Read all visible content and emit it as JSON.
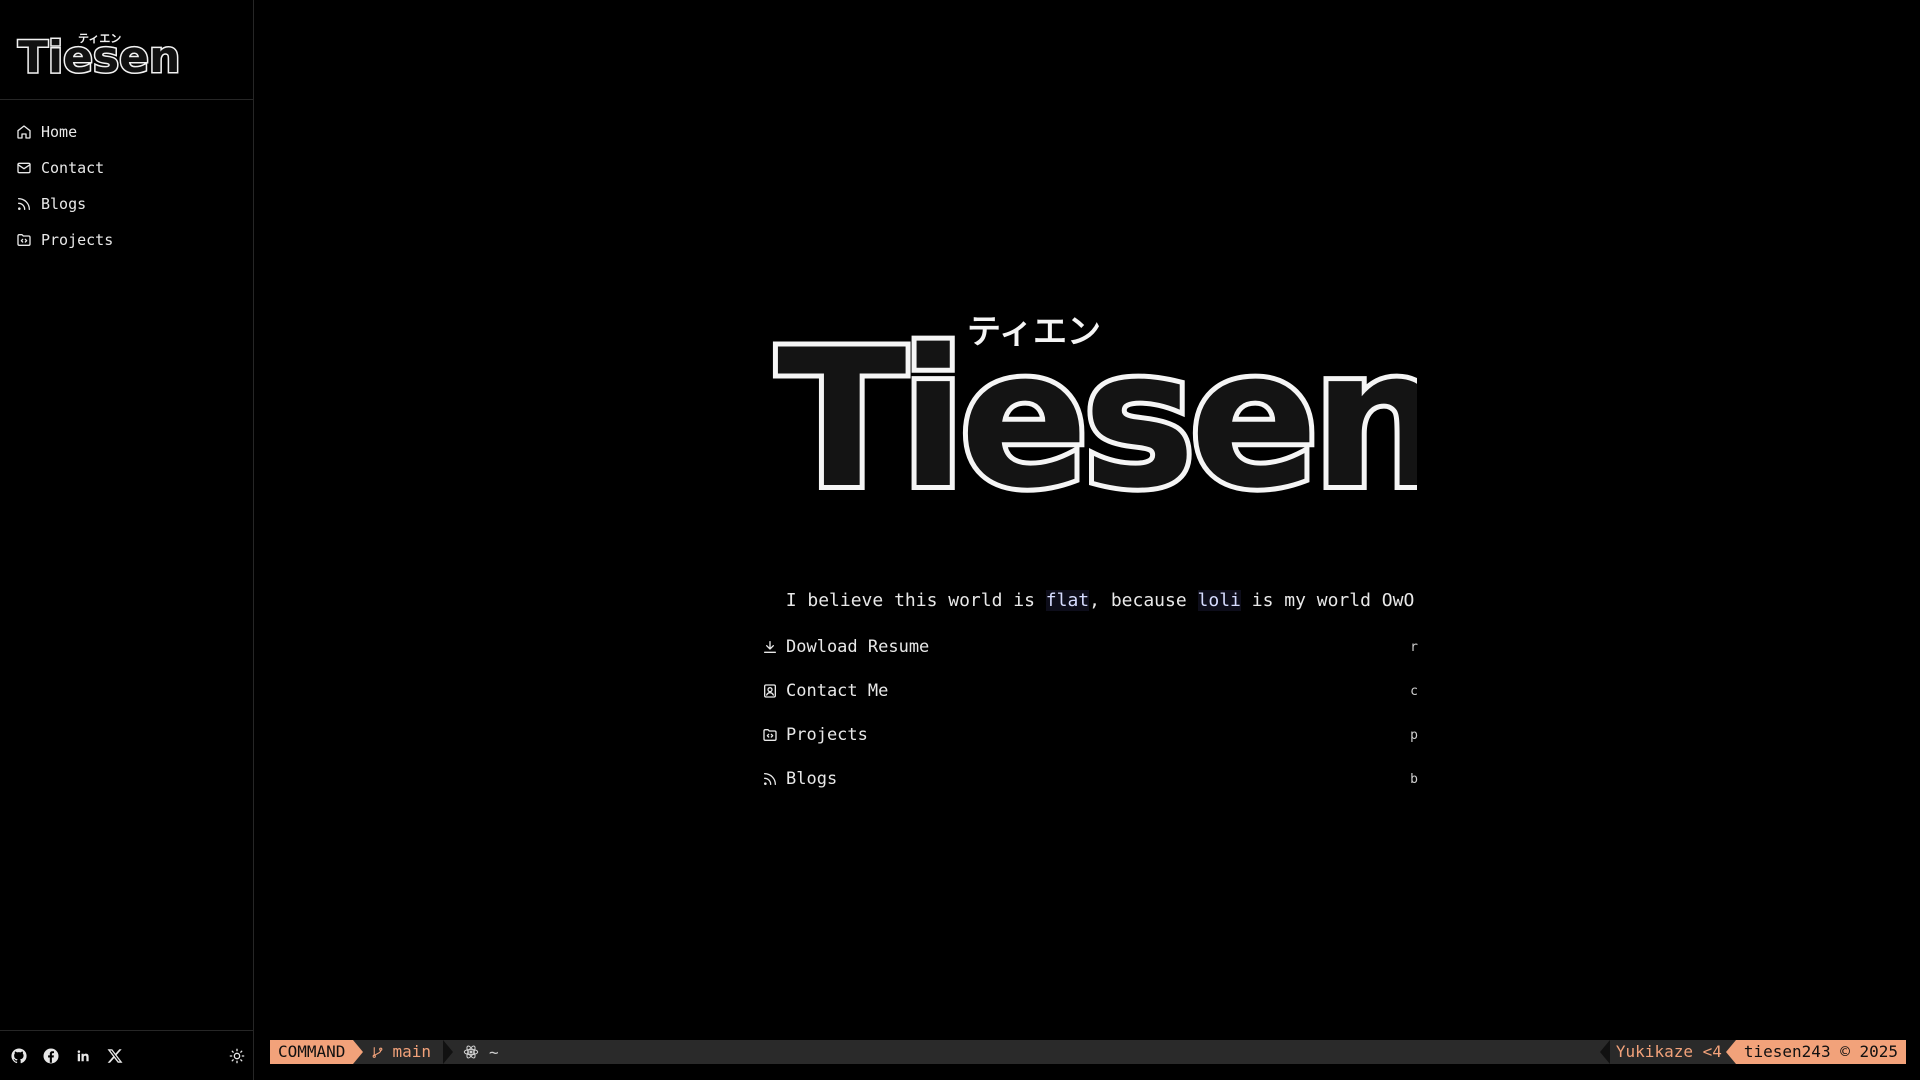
{
  "brand": {
    "logo_text": "Tiesen",
    "logo_subtitle": "ティエン"
  },
  "sidebar": {
    "items": [
      {
        "label": "Home",
        "icon": "home-icon"
      },
      {
        "label": "Contact",
        "icon": "mail-icon"
      },
      {
        "label": "Blogs",
        "icon": "rss-icon"
      },
      {
        "label": "Projects",
        "icon": "folder-code-icon"
      }
    ],
    "social": [
      "github-icon",
      "facebook-icon",
      "linkedin-icon",
      "x-icon"
    ],
    "theme_icon": "sun-icon"
  },
  "hero": {
    "logo_text": "Tiesen",
    "tagline": {
      "part1": "I believe this world is ",
      "flat": "flat",
      "part2": ", because ",
      "loli": "loli",
      "part3": " is my world OwO"
    }
  },
  "actions": [
    {
      "label": "Dowload Resume",
      "key": "r",
      "icon": "download-icon"
    },
    {
      "label": "Contact Me",
      "key": "c",
      "icon": "contact-icon"
    },
    {
      "label": "Projects",
      "key": "p",
      "icon": "folder-code-icon"
    },
    {
      "label": "Blogs",
      "key": "b",
      "icon": "rss-icon"
    }
  ],
  "statusbar": {
    "mode": "COMMAND",
    "branch": "main",
    "cwd": "~",
    "user": "Yukikaze <4",
    "copyright": "tiesen243 © 2025",
    "accent": "#f2a27a"
  }
}
